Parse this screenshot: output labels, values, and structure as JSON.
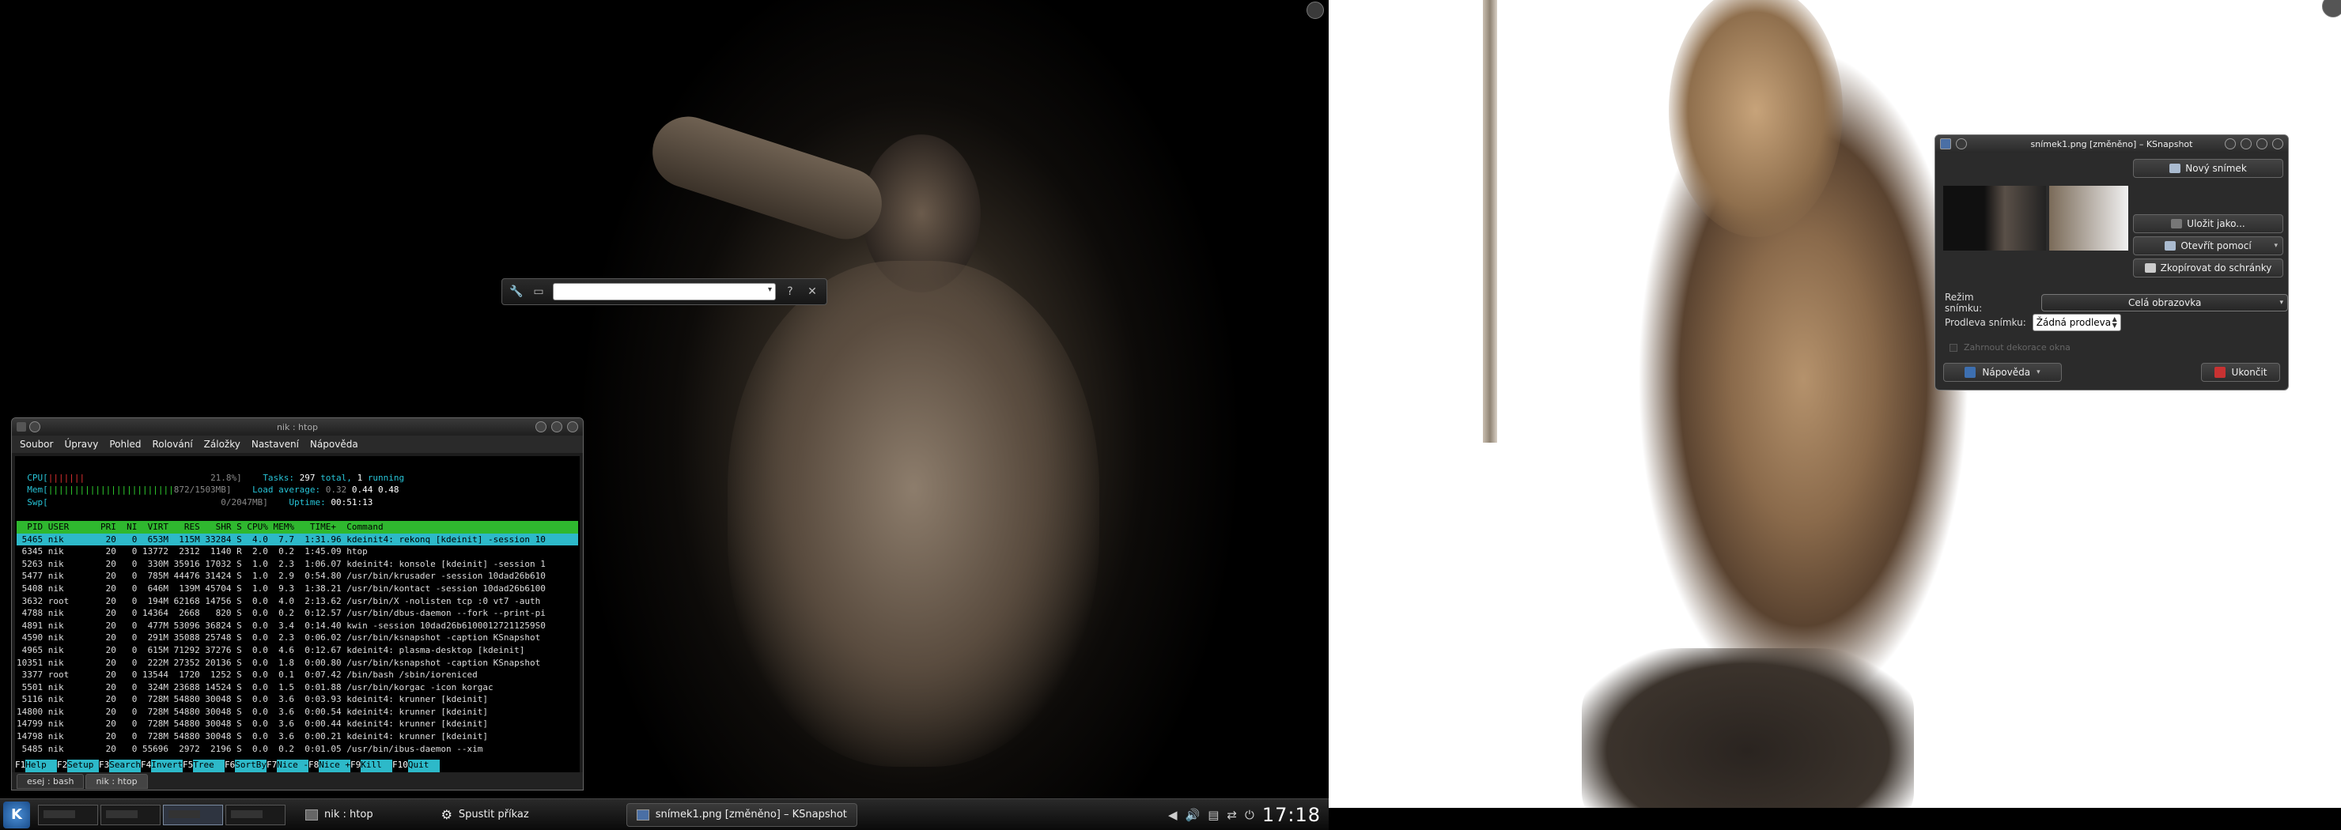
{
  "krunner": {
    "icons": [
      "wrench-icon",
      "activity-icon"
    ],
    "help_glyph": "?",
    "close_glyph": "✕",
    "dropdown_glyph": "▾"
  },
  "konsole": {
    "title": "nik : htop",
    "menu": [
      "Soubor",
      "Úpravy",
      "Pohled",
      "Rolování",
      "Záložky",
      "Nastavení",
      "Nápověda"
    ],
    "htop": {
      "cpu_label": "CPU[",
      "cpu_bar": "|||||||",
      "cpu_value": "21.8%]",
      "mem_label": "Mem[",
      "mem_bar": "||||||||||||||||||||||||",
      "mem_value": "872/1503MB]",
      "swp_label": "Swp[",
      "swp_value": "0/2047MB]",
      "tasks_label": "Tasks:",
      "tasks_total": "297",
      "tasks_rest": "total,",
      "tasks_running": "1",
      "tasks_running_label": "running",
      "load_label": "Load average:",
      "load_1": "0.32",
      "load_5": "0.44",
      "load_15": "0.48",
      "uptime_label": "Uptime:",
      "uptime": "00:51:13",
      "header": "  PID USER      PRI  NI  VIRT   RES   SHR S CPU% MEM%   TIME+  Command",
      "rows": [
        " 5465 nik        20   0  653M  115M 33284 S  4.0  7.7  1:31.96 kdeinit4: rekonq [kdeinit] -session 10",
        " 6345 nik        20   0 13772  2312  1140 R  2.0  0.2  1:45.09 htop",
        " 5263 nik        20   0  330M 35916 17032 S  1.0  2.3  1:06.07 kdeinit4: konsole [kdeinit] -session 1",
        " 5477 nik        20   0  785M 44476 31424 S  1.0  2.9  0:54.80 /usr/bin/krusader -session 10dad26b610",
        " 5408 nik        20   0  646M  139M 45704 S  1.0  9.3  1:38.21 /usr/bin/kontact -session 10dad26b6100",
        " 3632 root       20   0  194M 62168 14756 S  0.0  4.0  2:13.62 /usr/bin/X -nolisten tcp :0 vt7 -auth",
        " 4788 nik        20   0 14364  2668   820 S  0.0  0.2  0:12.57 /usr/bin/dbus-daemon --fork --print-pi",
        " 4891 nik        20   0  477M 53096 36824 S  0.0  3.4  0:14.40 kwin -session 10dad26b61000127211259S0",
        " 4590 nik        20   0  291M 35088 25748 S  0.0  2.3  0:06.02 /usr/bin/ksnapshot -caption KSnapshot",
        " 4965 nik        20   0  615M 71292 37276 S  0.0  4.6  0:12.67 kdeinit4: plasma-desktop [kdeinit]",
        "10351 nik        20   0  222M 27352 20136 S  0.0  1.8  0:00.80 /usr/bin/ksnapshot -caption KSnapshot",
        " 3377 root       20   0 13544  1720  1252 S  0.0  0.1  0:07.42 /bin/bash /sbin/ioreniced",
        " 5501 nik        20   0  324M 23688 14524 S  0.0  1.5  0:01.88 /usr/bin/korgac -icon korgac",
        " 5116 nik        20   0  728M 54880 30048 S  0.0  3.6  0:03.93 kdeinit4: krunner [kdeinit]",
        "14800 nik        20   0  728M 54880 30048 S  0.0  3.6  0:00.54 kdeinit4: krunner [kdeinit]",
        "14799 nik        20   0  728M 54880 30048 S  0.0  3.6  0:00.44 kdeinit4: krunner [kdeinit]",
        "14798 nik        20   0  728M 54880 30048 S  0.0  3.6  0:00.21 kdeinit4: krunner [kdeinit]",
        " 5485 nik        20   0 55696  2972  2196 S  0.0  0.2  0:01.05 /usr/bin/ibus-daemon --xim"
      ],
      "fkeys": [
        {
          "key": "F1",
          "label": "Help  "
        },
        {
          "key": "F2",
          "label": "Setup "
        },
        {
          "key": "F3",
          "label": "Search"
        },
        {
          "key": "F4",
          "label": "Invert"
        },
        {
          "key": "F5",
          "label": "Tree  "
        },
        {
          "key": "F6",
          "label": "SortBy"
        },
        {
          "key": "F7",
          "label": "Nice -"
        },
        {
          "key": "F8",
          "label": "Nice +"
        },
        {
          "key": "F9",
          "label": "Kill  "
        },
        {
          "key": "F10",
          "label": "Quit  "
        }
      ]
    },
    "tabs": [
      "esej : bash",
      "nik : htop"
    ]
  },
  "ksnapshot": {
    "title": "snímek1.png [změněno] – KSnapshot",
    "new_button": "Nový snímek",
    "save_as_button": "Uložit jako...",
    "open_with_button": "Otevřít pomocí",
    "copy_button": "Zkopírovat do schránky",
    "mode_label": "Režim snímku:",
    "mode_value": "Celá obrazovka",
    "delay_label": "Prodleva snímku:",
    "delay_value": "Žádná prodleva",
    "include_decorations_label": "Zahrnout dekorace okna",
    "help_button": "Nápověda",
    "quit_button": "Ukončit"
  },
  "panel": {
    "kmenu_glyph": "K",
    "tasks": [
      {
        "label": "nik : htop",
        "active": false
      },
      {
        "label": "Spustit příkaz",
        "active": false
      },
      {
        "label": "snímek1.png [změněno] – KSnapshot",
        "active": true
      }
    ],
    "clock": "17:18",
    "tray_icons": [
      "media-previous-icon",
      "volume-icon",
      "clipboard-icon",
      "network-icon",
      "power-icon"
    ]
  },
  "colors": {
    "htop_green": "#2fb82f",
    "htop_cyan": "#2db9c9",
    "kde_blue": "#2b6cc4"
  }
}
